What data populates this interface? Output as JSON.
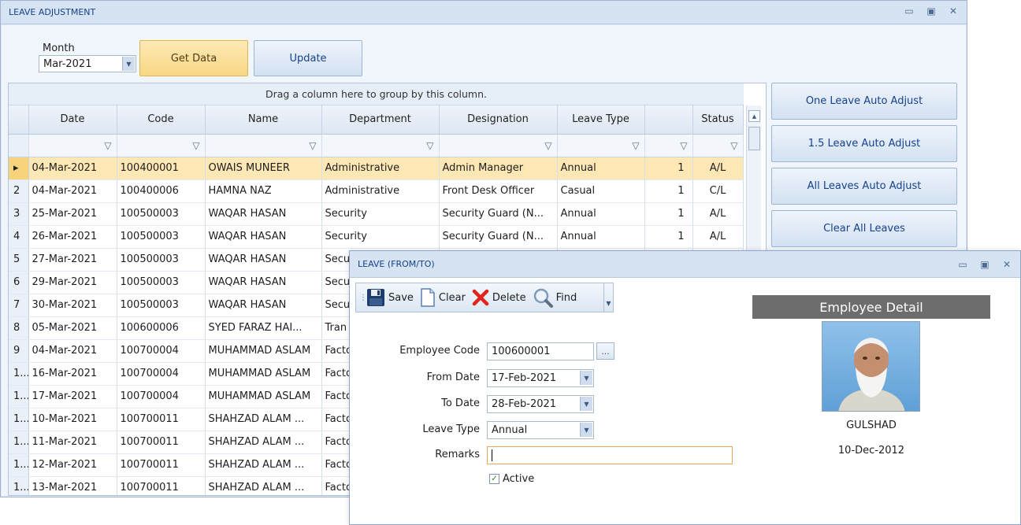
{
  "main_window": {
    "title": "LEAVE ADJUSTMENT",
    "month_label": "Month",
    "month_value": "Mar-2021",
    "get_data_label": "Get Data",
    "update_label": "Update",
    "side_buttons": [
      "One Leave Auto Adjust",
      "1.5 Leave Auto Adjust",
      "All Leaves Auto Adjust",
      "Clear All Leaves"
    ]
  },
  "grid": {
    "group_hint": "Drag a column here to group by this column.",
    "columns": [
      "Date",
      "Code",
      "Name",
      "Department",
      "Designation",
      "Leave Type",
      "",
      "Status"
    ],
    "rows": [
      {
        "ind": "",
        "date": "04-Mar-2021",
        "code": "100400001",
        "name": "OWAIS MUNEER",
        "dept": "Administrative",
        "desig": "Admin Manager",
        "type": "Annual",
        "days": "1",
        "status": "A/L"
      },
      {
        "ind": "2",
        "date": "04-Mar-2021",
        "code": "100400006",
        "name": "HAMNA NAZ",
        "dept": "Administrative",
        "desig": "Front Desk Officer",
        "type": "Casual",
        "days": "1",
        "status": "C/L"
      },
      {
        "ind": "3",
        "date": "25-Mar-2021",
        "code": "100500003",
        "name": "WAQAR HASAN",
        "dept": "Security",
        "desig": "Security Guard (N...",
        "type": "Annual",
        "days": "1",
        "status": "A/L"
      },
      {
        "ind": "4",
        "date": "26-Mar-2021",
        "code": "100500003",
        "name": "WAQAR HASAN",
        "dept": "Security",
        "desig": "Security Guard (N...",
        "type": "Annual",
        "days": "1",
        "status": "A/L"
      },
      {
        "ind": "5",
        "date": "27-Mar-2021",
        "code": "100500003",
        "name": "WAQAR HASAN",
        "dept": "Secu",
        "desig": "",
        "type": "",
        "days": "",
        "status": ""
      },
      {
        "ind": "6",
        "date": "29-Mar-2021",
        "code": "100500003",
        "name": "WAQAR HASAN",
        "dept": "Secu",
        "desig": "",
        "type": "",
        "days": "",
        "status": ""
      },
      {
        "ind": "7",
        "date": "30-Mar-2021",
        "code": "100500003",
        "name": "WAQAR HASAN",
        "dept": "Secu",
        "desig": "",
        "type": "",
        "days": "",
        "status": ""
      },
      {
        "ind": "8",
        "date": "05-Mar-2021",
        "code": "100600006",
        "name": "SYED FARAZ HAI...",
        "dept": "Tran",
        "desig": "",
        "type": "",
        "days": "",
        "status": ""
      },
      {
        "ind": "9",
        "date": "04-Mar-2021",
        "code": "100700004",
        "name": "MUHAMMAD ASLAM",
        "dept": "Facto",
        "desig": "",
        "type": "",
        "days": "",
        "status": ""
      },
      {
        "ind": "1...",
        "date": "16-Mar-2021",
        "code": "100700004",
        "name": "MUHAMMAD ASLAM",
        "dept": "Facto",
        "desig": "",
        "type": "",
        "days": "",
        "status": ""
      },
      {
        "ind": "1...",
        "date": "17-Mar-2021",
        "code": "100700004",
        "name": "MUHAMMAD ASLAM",
        "dept": "Facto",
        "desig": "",
        "type": "",
        "days": "",
        "status": ""
      },
      {
        "ind": "1...",
        "date": "10-Mar-2021",
        "code": "100700011",
        "name": "SHAHZAD ALAM ...",
        "dept": "Facto",
        "desig": "",
        "type": "",
        "days": "",
        "status": ""
      },
      {
        "ind": "1...",
        "date": "11-Mar-2021",
        "code": "100700011",
        "name": "SHAHZAD ALAM ...",
        "dept": "Facto",
        "desig": "",
        "type": "",
        "days": "",
        "status": ""
      },
      {
        "ind": "1...",
        "date": "12-Mar-2021",
        "code": "100700011",
        "name": "SHAHZAD ALAM ...",
        "dept": "Facto",
        "desig": "",
        "type": "",
        "days": "",
        "status": ""
      },
      {
        "ind": "1...",
        "date": "13-Mar-2021",
        "code": "100700011",
        "name": "SHAHZAD ALAM ...",
        "dept": "Facto",
        "desig": "",
        "type": "",
        "days": "",
        "status": ""
      }
    ]
  },
  "popup": {
    "title": "LEAVE (FROM/TO)",
    "toolbar": {
      "save": "Save",
      "clear": "Clear",
      "delete": "Delete",
      "find": "Find"
    },
    "fields": {
      "employee_code_label": "Employee Code",
      "employee_code": "100600001",
      "ellipsis": "...",
      "from_date_label": "From Date",
      "from_date": "17-Feb-2021",
      "to_date_label": "To Date",
      "to_date": "28-Feb-2021",
      "leave_type_label": "Leave Type",
      "leave_type": "Annual",
      "remarks_label": "Remarks",
      "remarks": "",
      "active_label": "Active"
    },
    "employee_detail": {
      "header": "Employee Detail",
      "name": "GULSHAD",
      "date": "10-Dec-2012"
    }
  }
}
